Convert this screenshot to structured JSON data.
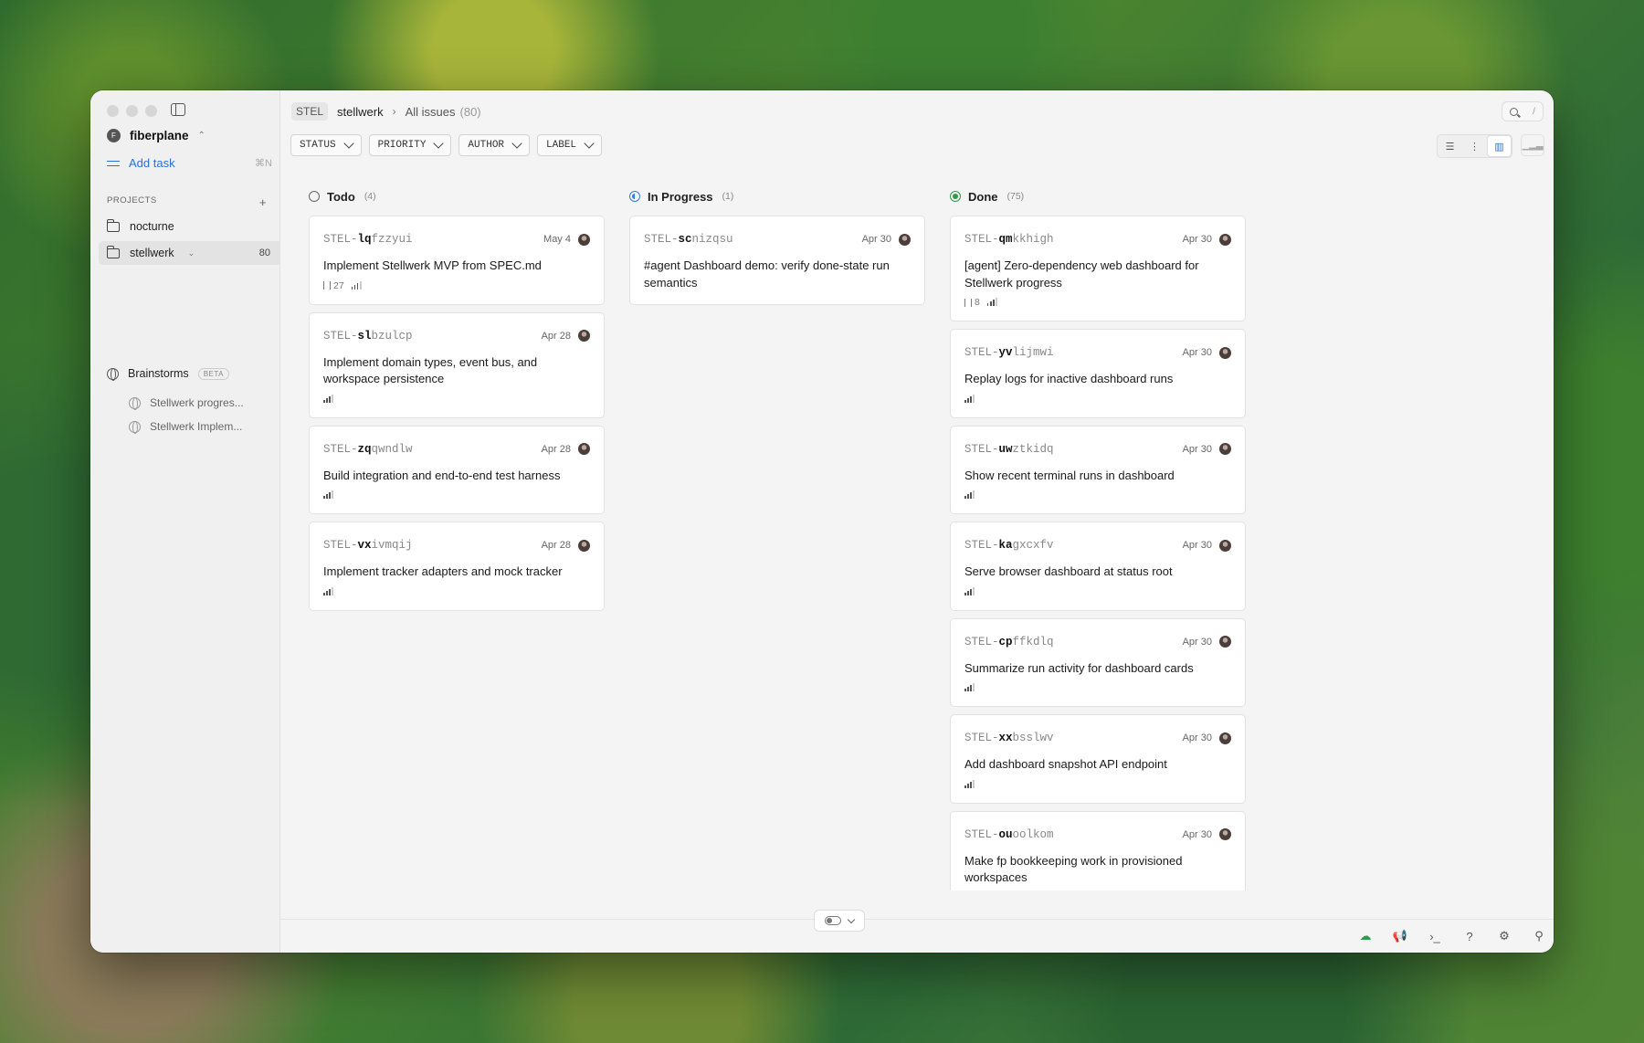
{
  "sidebar": {
    "workspace": {
      "initial": "F",
      "name": "fiberplane"
    },
    "add_task": {
      "label": "Add task",
      "shortcut": "⌘N"
    },
    "projects_title": "PROJECTS",
    "projects": [
      {
        "name": "nocturne",
        "count": ""
      },
      {
        "name": "stellwerk",
        "count": "80"
      }
    ],
    "brainstorms": {
      "label": "Brainstorms",
      "badge": "BETA",
      "items": [
        "Stellwerk progres...",
        "Stellwerk Implem..."
      ]
    }
  },
  "header": {
    "key": "STEL",
    "project": "stellwerk",
    "view": "All issues",
    "count": "(80)",
    "search_shortcut": "/"
  },
  "filters": [
    "STATUS",
    "PRIORITY",
    "AUTHOR",
    "LABEL"
  ],
  "columns": [
    {
      "name": "Todo",
      "count": "(4)",
      "status": "todo",
      "cards": [
        {
          "prefix": "STEL-",
          "bold": "lq",
          "rest": "fzzyui",
          "date": "May 4",
          "title": "Implement Stellwerk MVP from SPEC.md",
          "pr": "27"
        },
        {
          "prefix": "STEL-",
          "bold": "sl",
          "rest": "bzulcp",
          "date": "Apr 28",
          "title": "Implement domain types, event bus, and workspace persistence",
          "pr": ""
        },
        {
          "prefix": "STEL-",
          "bold": "zq",
          "rest": "qwndlw",
          "date": "Apr 28",
          "title": "Build integration and end-to-end test harness",
          "pr": ""
        },
        {
          "prefix": "STEL-",
          "bold": "vx",
          "rest": "ivmqij",
          "date": "Apr 28",
          "title": "Implement tracker adapters and mock tracker",
          "pr": ""
        }
      ]
    },
    {
      "name": "In Progress",
      "count": "(1)",
      "status": "progress",
      "cards": [
        {
          "prefix": "STEL-",
          "bold": "sc",
          "rest": "nizqsu",
          "date": "Apr 30",
          "title": "#agent Dashboard demo: verify done-state run semantics",
          "pr": "",
          "no_meta": true
        }
      ]
    },
    {
      "name": "Done",
      "count": "(75)",
      "status": "done",
      "cards": [
        {
          "prefix": "STEL-",
          "bold": "qm",
          "rest": "kkhigh",
          "date": "Apr 30",
          "title": "[agent] Zero-dependency web dashboard for Stellwerk progress",
          "pr": "8"
        },
        {
          "prefix": "STEL-",
          "bold": "yv",
          "rest": "lijmwi",
          "date": "Apr 30",
          "title": "Replay logs for inactive dashboard runs",
          "pr": ""
        },
        {
          "prefix": "STEL-",
          "bold": "uw",
          "rest": "ztkidq",
          "date": "Apr 30",
          "title": "Show recent terminal runs in dashboard",
          "pr": ""
        },
        {
          "prefix": "STEL-",
          "bold": "ka",
          "rest": "gxcxfv",
          "date": "Apr 30",
          "title": "Serve browser dashboard at status root",
          "pr": ""
        },
        {
          "prefix": "STEL-",
          "bold": "cp",
          "rest": "ffkdlq",
          "date": "Apr 30",
          "title": "Summarize run activity for dashboard cards",
          "pr": ""
        },
        {
          "prefix": "STEL-",
          "bold": "xx",
          "rest": "bsslwv",
          "date": "Apr 30",
          "title": "Add dashboard snapshot API endpoint",
          "pr": ""
        },
        {
          "prefix": "STEL-",
          "bold": "ou",
          "rest": "oolkom",
          "date": "Apr 30",
          "title": "Make fp bookkeeping work in provisioned workspaces",
          "pr": ""
        }
      ]
    }
  ],
  "colors": {
    "accent": "#2b6fd4",
    "in_progress": "#2b7fe0",
    "done": "#2e9a4a"
  }
}
